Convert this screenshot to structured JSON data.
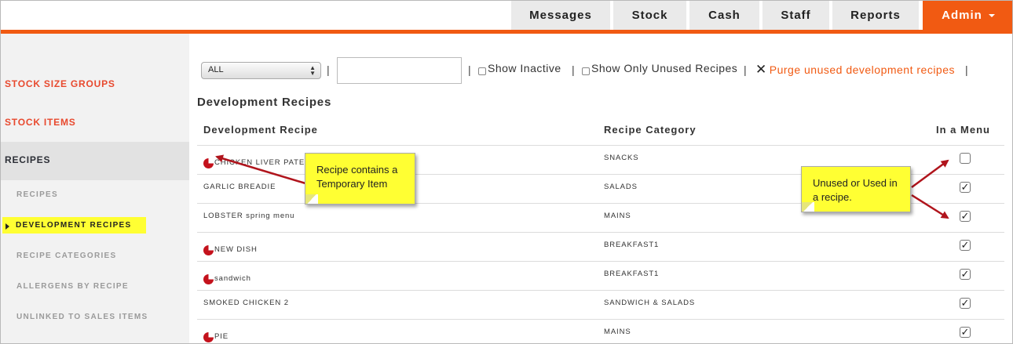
{
  "nav": {
    "tabs": [
      "Messages",
      "Stock",
      "Cash",
      "Staff",
      "Reports"
    ],
    "admin_label": "Admin"
  },
  "sidebar": {
    "sections": [
      "STOCK SIZE GROUPS",
      "STOCK ITEMS",
      "RECIPES"
    ],
    "subitems": [
      "RECIPES",
      "DEVELOPMENT RECIPES",
      "RECIPE CATEGORIES",
      "ALLERGENS BY RECIPE",
      "UNLINKED TO SALES ITEMS"
    ]
  },
  "filters": {
    "select_value": "ALL",
    "search_value": "",
    "show_inactive": "Show Inactive",
    "show_only_unused": "Show Only Unused Recipes",
    "purge_label": "Purge unused development recipes",
    "separator": "|"
  },
  "page_title": "Development Recipes",
  "table": {
    "headers": [
      "Development Recipe",
      "Recipe Category",
      "In a Menu"
    ],
    "rows": [
      {
        "name": "CHICKEN LIVER PATE",
        "category": "SNACKS",
        "temp": true,
        "in_menu": false
      },
      {
        "name": "GARLIC BREADIE",
        "category": "SALADS",
        "temp": false,
        "in_menu": true
      },
      {
        "name": "LOBSTER spring menu",
        "category": "MAINS",
        "temp": false,
        "in_menu": true
      },
      {
        "name": "NEW DISH",
        "category": "BREAKFAST1",
        "temp": true,
        "in_menu": true
      },
      {
        "name": "sandwich",
        "category": "BREAKFAST1",
        "temp": true,
        "in_menu": true
      },
      {
        "name": "SMOKED CHICKEN 2",
        "category": "SANDWICH & SALADS",
        "temp": false,
        "in_menu": true
      },
      {
        "name": "PIE",
        "category": "MAINS",
        "temp": true,
        "in_menu": true
      }
    ]
  },
  "callouts": {
    "temporary": "Recipe contains a Temporary Item",
    "unused": "Unused or Used in a recipe."
  },
  "colors": {
    "accent": "#f15a12",
    "highlight": "#ffff33",
    "temp_marker": "#c4121c"
  }
}
